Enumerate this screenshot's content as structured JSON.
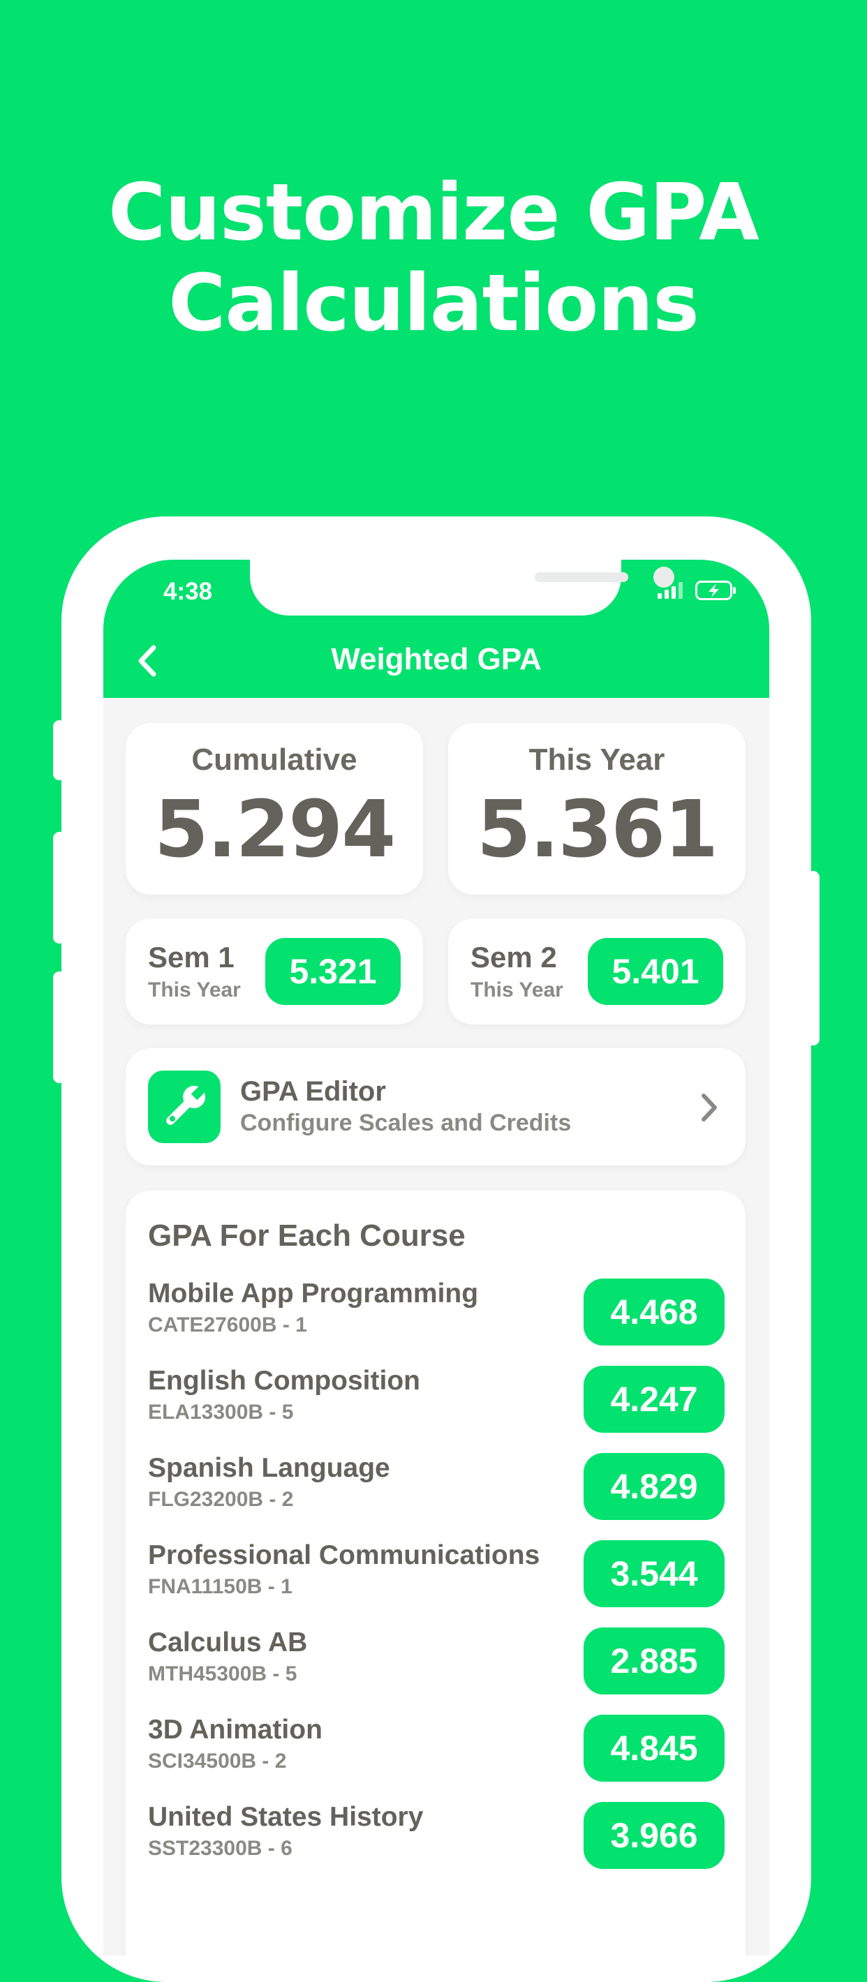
{
  "headline": {
    "line1": "Customize GPA",
    "line2": "Calculations"
  },
  "status_bar": {
    "time": "4:38"
  },
  "nav": {
    "title": "Weighted GPA"
  },
  "summary": {
    "cumulative": {
      "label": "Cumulative",
      "value": "5.294"
    },
    "this_year": {
      "label": "This Year",
      "value": "5.361"
    }
  },
  "semesters": [
    {
      "label": "Sem 1",
      "sub": "This Year",
      "value": "5.321"
    },
    {
      "label": "Sem 2",
      "sub": "This Year",
      "value": "5.401"
    }
  ],
  "editor": {
    "title": "GPA Editor",
    "subtitle": "Configure Scales and Credits"
  },
  "courses": {
    "title": "GPA For Each Course",
    "items": [
      {
        "name": "Mobile App Programming",
        "code": "CATE27600B - 1",
        "gpa": "4.468"
      },
      {
        "name": "English Composition",
        "code": "ELA13300B - 5",
        "gpa": "4.247"
      },
      {
        "name": "Spanish Language",
        "code": "FLG23200B - 2",
        "gpa": "4.829"
      },
      {
        "name": "Professional Communications",
        "code": "FNA11150B - 1",
        "gpa": "3.544"
      },
      {
        "name": "Calculus AB",
        "code": "MTH45300B - 5",
        "gpa": "2.885"
      },
      {
        "name": "3D Animation",
        "code": "SCI34500B - 2",
        "gpa": "4.845"
      },
      {
        "name": "United States History",
        "code": "SST23300B - 6",
        "gpa": "3.966"
      }
    ]
  },
  "colors": {
    "brand_green": "#03e16f",
    "text_dark": "#63635b",
    "text_muted": "#8a8a84",
    "screen_bg": "#f4f5f4"
  },
  "icons": {
    "back": "chevron-left-icon",
    "editor": "wrench-icon",
    "editor_arrow": "chevron-right-icon",
    "signal": "cellular-signal-icon",
    "battery": "battery-charging-icon"
  }
}
